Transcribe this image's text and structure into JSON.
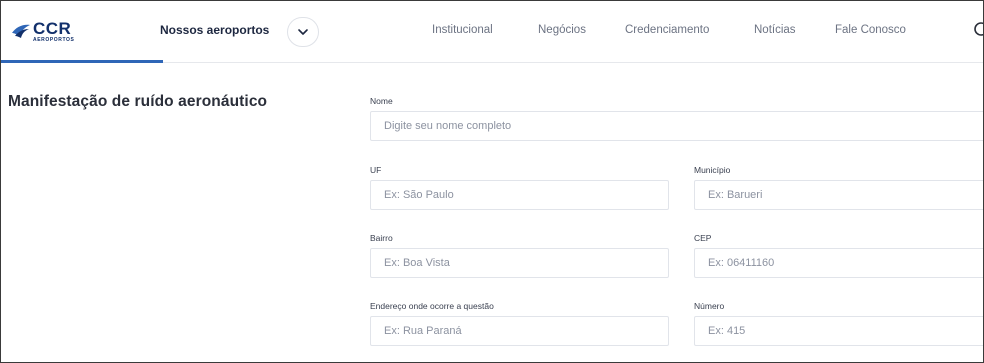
{
  "header": {
    "logo": {
      "text": "CCR",
      "sub": "AEROPORTOS",
      "color": "#12306b",
      "accent": "#2f66b7"
    },
    "airports_menu": {
      "label": "Nossos aeroportos",
      "icon": "chevron-down-icon"
    },
    "nav": [
      {
        "label": "Institucional"
      },
      {
        "label": "Negócios"
      },
      {
        "label": "Credenciamento"
      },
      {
        "label": "Notícias"
      },
      {
        "label": "Fale Conosco"
      }
    ],
    "search_icon": "search-icon"
  },
  "page": {
    "title": "Manifestação de ruído aeronáutico"
  },
  "form": {
    "nome": {
      "label": "Nome",
      "placeholder": "Digite seu nome completo"
    },
    "uf": {
      "label": "UF",
      "placeholder": "Ex: São Paulo"
    },
    "municipio": {
      "label": "Município",
      "placeholder": "Ex: Barueri"
    },
    "bairro": {
      "label": "Bairro",
      "placeholder": "Ex: Boa Vista"
    },
    "cep": {
      "label": "CEP",
      "placeholder": "Ex: 06411160"
    },
    "endereco": {
      "label": "Endereço onde ocorre a questão",
      "placeholder": "Ex: Rua Paraná"
    },
    "numero": {
      "label": "Número",
      "placeholder": "Ex: 415"
    }
  }
}
